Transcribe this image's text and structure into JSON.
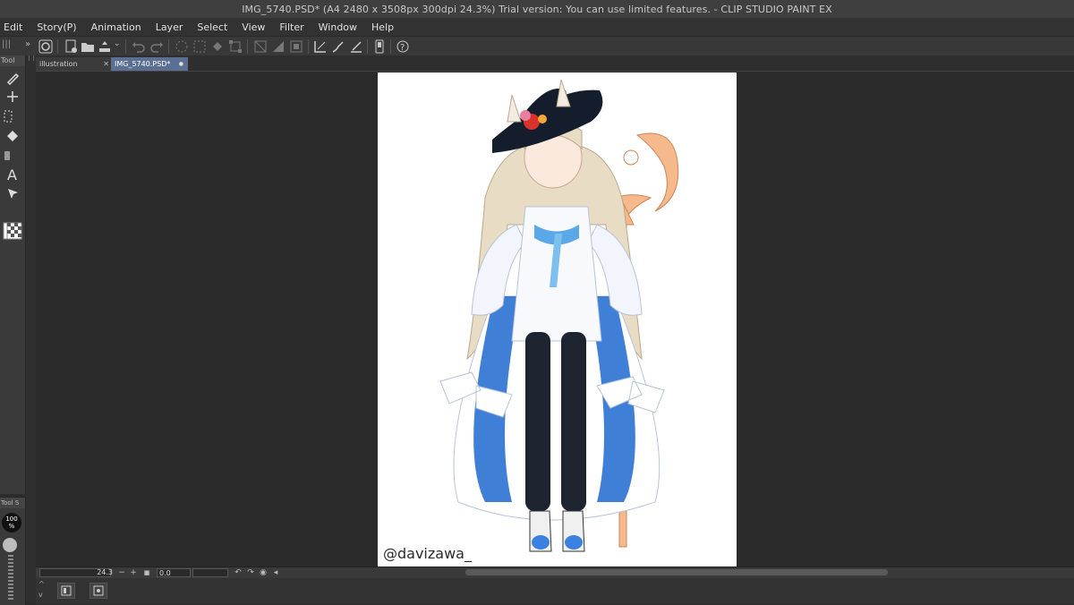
{
  "window": {
    "title": "IMG_5740.PSD* (A4 2480 x 3508px 300dpi 24.3%)  Trial version: You can use limited features. - CLIP STUDIO PAINT EX"
  },
  "menu": {
    "items": [
      "Edit",
      "Story(P)",
      "Animation",
      "Layer",
      "Select",
      "View",
      "Filter",
      "Window",
      "Help"
    ]
  },
  "toolbar": {
    "icons": [
      "clip-studio-icon",
      "new-file-icon",
      "open-file-icon",
      "save-icon",
      "undo-icon",
      "redo-icon",
      "clear-icon",
      "fill-icon",
      "transform-icon",
      "snap-off-icon",
      "snap-ruler-icon",
      "snap-grid-icon",
      "show-ruler-icon",
      "edit-layer-icon",
      "correct-line-icon",
      "smartphone-icon",
      "help-icon"
    ]
  },
  "tool_panel": {
    "header": "Tool"
  },
  "sub_tool_panel": {
    "header": "Tool S",
    "opacity": "100\n%"
  },
  "tabs": [
    {
      "label": "illustration",
      "active": false,
      "close": "✕"
    },
    {
      "label": "IMG_5740.PSD*",
      "active": true,
      "close": "●"
    }
  ],
  "canvas": {
    "watermark": "@davizawa_"
  },
  "status": {
    "zoom": "24.3",
    "rotation": "0.0"
  },
  "colors": {
    "accent_tab": "#5a6f91",
    "background": "#2b2b2b",
    "paper": "#ffffff"
  }
}
